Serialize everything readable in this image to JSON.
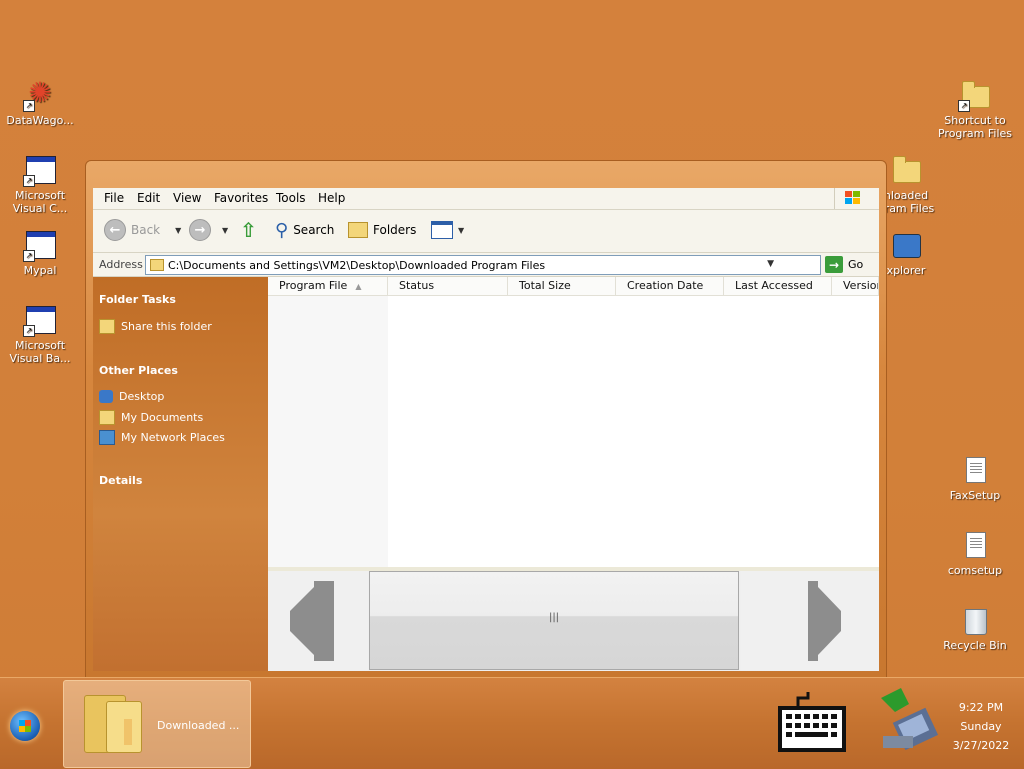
{
  "desktop": {
    "icons_left": [
      {
        "label": "DataWago...",
        "icon": "datawagon-icon"
      },
      {
        "label": "Microsoft\nVisual C...",
        "icon": "app-window-icon"
      },
      {
        "label": "Mypal",
        "icon": "app-window-icon"
      },
      {
        "label": "Microsoft\nVisual Ba...",
        "icon": "app-window-icon"
      }
    ],
    "icons_right": [
      {
        "label": "Shortcut to\nProgram Files",
        "icon": "folder-icon"
      },
      {
        "label": "nloaded\ngram Files",
        "icon": "folder-icon"
      },
      {
        "label": "xplorer",
        "icon": "network-icon"
      },
      {
        "label": "FaxSetup",
        "icon": "document-icon"
      },
      {
        "label": "comsetup",
        "icon": "document-icon"
      },
      {
        "label": "Recycle Bin",
        "icon": "recycle-bin-icon"
      }
    ]
  },
  "window": {
    "menu": [
      "File",
      "Edit",
      "View",
      "Favorites",
      "Tools",
      "Help"
    ],
    "toolbar": {
      "back": "Back",
      "search": "Search",
      "folders": "Folders"
    },
    "address": {
      "label": "Address",
      "value": "C:\\Documents and Settings\\VM2\\Desktop\\Downloaded Program Files",
      "go": "Go"
    },
    "taskpane": {
      "folder_tasks": "Folder Tasks",
      "share": "Share this folder",
      "other_places": "Other Places",
      "places": [
        "Desktop",
        "My Documents",
        "My Network Places"
      ],
      "details": "Details"
    },
    "columns": [
      "Program File",
      "Status",
      "Total Size",
      "Creation Date",
      "Last Accessed",
      "Version"
    ]
  },
  "taskbar": {
    "task_label": "Downloaded ...",
    "clock": {
      "time": "9:22 PM",
      "day": "Sunday",
      "date": "3/27/2022"
    }
  },
  "colors": {
    "desktop": "#d4813c",
    "accent_blue": "#1f3fb0",
    "go_green": "#3a9c3a"
  }
}
